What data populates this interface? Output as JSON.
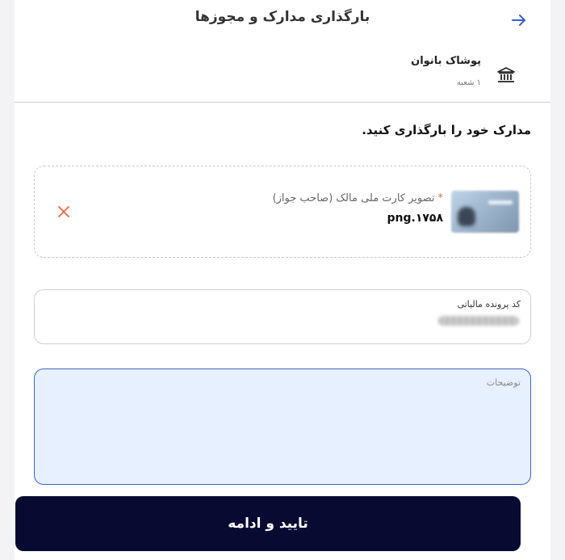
{
  "header": {
    "title": "بارگذاری مدارک و مجوزها",
    "back_icon": "arrow-right-icon"
  },
  "store": {
    "name": "پوشاک بانوان",
    "branch": "۱ شعبه",
    "icon": "bank-building-icon"
  },
  "section_title": "مدارک خود را بارگذاری کنید.",
  "upload": {
    "label": "تصویر کارت ملی مالک (صاحب جواز)",
    "required_mark": "*",
    "file_name": "png.۱۷۵۸",
    "remove_icon": "close-icon",
    "accent_color": "#e0664a"
  },
  "tax_code": {
    "label": "کد پرونده مالیاتی"
  },
  "notes": {
    "placeholder": "توضیحات"
  },
  "submit": {
    "label": "تایید و ادامه",
    "color": "#080a31"
  }
}
